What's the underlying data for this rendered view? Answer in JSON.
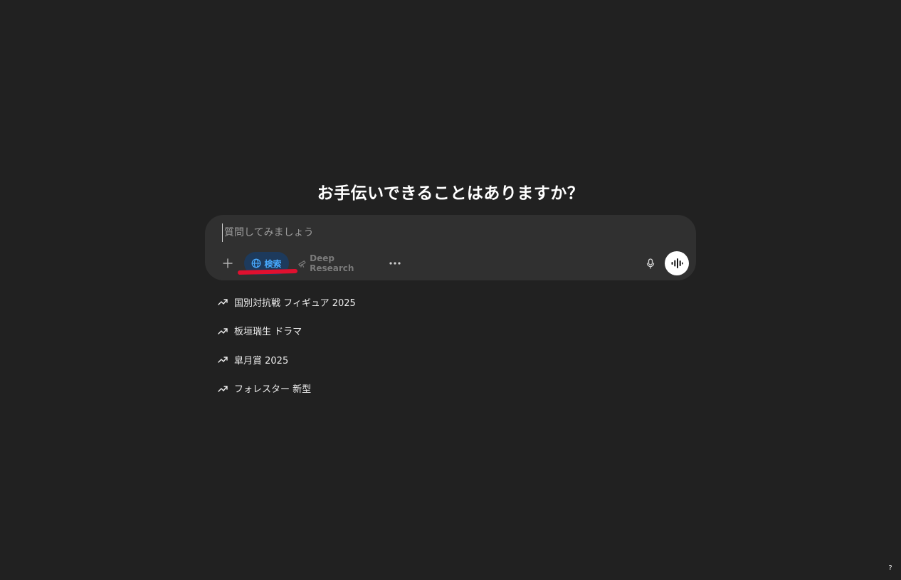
{
  "heading": "お手伝いできることはありますか？",
  "composer": {
    "placeholder": "質問してみましょう",
    "value": "",
    "tools": {
      "search_label": "検索",
      "deep_research_label": "Deep Research"
    }
  },
  "suggestions": [
    {
      "label": "国別対抗戦 フィギュア 2025",
      "icon": "trending-up-icon"
    },
    {
      "label": "板垣瑞生 ドラマ",
      "icon": "trending-up-icon"
    },
    {
      "label": "皐月賞 2025",
      "icon": "trending-up-icon"
    },
    {
      "label": "フォレスター 新型",
      "icon": "trending-up-icon"
    }
  ],
  "help": {
    "label": "?"
  },
  "colors": {
    "background": "#212121",
    "composer": "#303030",
    "search_active_bg": "#1d3a5c",
    "search_active_text": "#48aaff",
    "annotation_red": "#e0102f"
  }
}
